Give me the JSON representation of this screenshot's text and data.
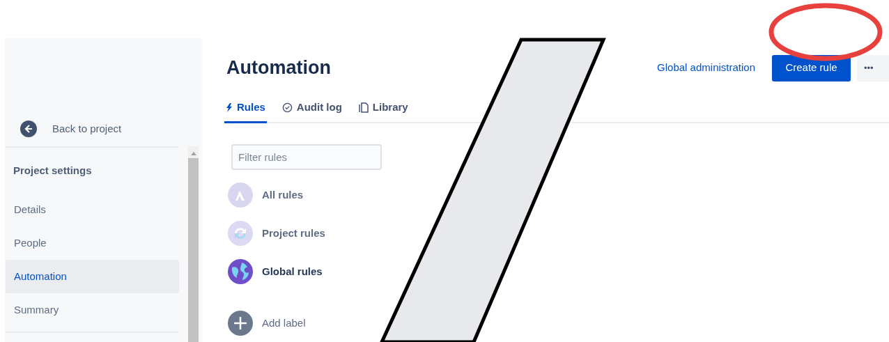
{
  "sidebar": {
    "back_link": "Back to project",
    "section_title": "Project settings",
    "items": [
      {
        "label": "Details",
        "selected": false
      },
      {
        "label": "People",
        "selected": false
      },
      {
        "label": "Automation",
        "selected": true
      },
      {
        "label": "Summary",
        "selected": false
      }
    ]
  },
  "header": {
    "title": "Automation",
    "global_link": "Global administration",
    "create_button": "Create rule",
    "more_button": "•••"
  },
  "tabs": [
    {
      "label": "Rules",
      "kind": "bolt",
      "selected": true
    },
    {
      "label": "Audit log",
      "kind": "check",
      "selected": false
    },
    {
      "label": "Library",
      "kind": "copy",
      "selected": false
    }
  ],
  "filter": {
    "placeholder": "Filter rules"
  },
  "rule_groups": [
    {
      "label": "All rules",
      "kind": "peak",
      "selected": false
    },
    {
      "label": "Project rules",
      "kind": "cycle",
      "selected": false
    },
    {
      "label": "Global rules",
      "kind": "globe",
      "selected": true
    }
  ],
  "add_label": "Add label"
}
